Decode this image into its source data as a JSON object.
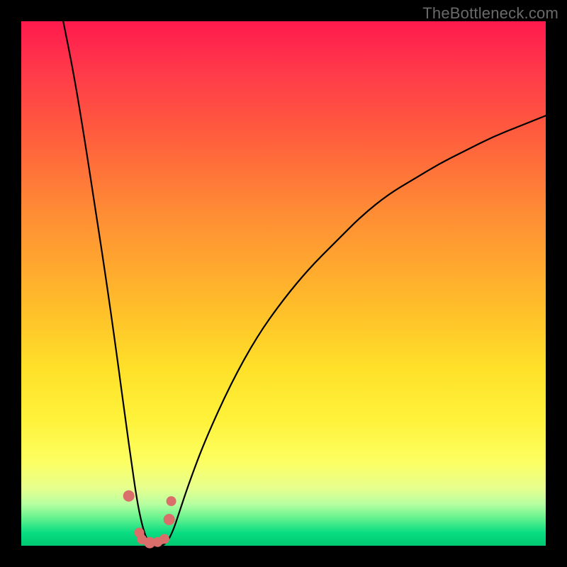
{
  "attribution": "TheBottleneck.com",
  "colors": {
    "background": "#000000",
    "gradient_top": "#ff1a4d",
    "gradient_bottom": "#01c973",
    "curve": "#000000",
    "marker": "#d96e6a"
  },
  "chart_data": {
    "type": "line",
    "title": "",
    "xlabel": "",
    "ylabel": "",
    "xlim": [
      0,
      100
    ],
    "ylim": [
      0,
      100
    ],
    "x": [
      8,
      10,
      12,
      14,
      16,
      18,
      20,
      21,
      22,
      23,
      24,
      25,
      26,
      27,
      28,
      29,
      30,
      32,
      35,
      40,
      45,
      50,
      55,
      60,
      65,
      70,
      75,
      80,
      85,
      90,
      95,
      100
    ],
    "values": [
      100,
      90,
      78,
      65,
      52,
      38,
      23,
      16,
      9,
      4,
      1,
      0,
      0,
      0,
      1,
      3,
      6,
      12,
      20,
      31,
      40,
      47,
      53,
      58,
      63,
      67,
      70,
      73,
      75.5,
      78,
      80,
      82
    ],
    "markers": {
      "x": [
        20.5,
        22.5,
        23.0,
        24.5,
        26.0,
        27.3,
        28.2,
        28.6
      ],
      "y": [
        9.5,
        2.5,
        1.2,
        0.6,
        0.7,
        1.3,
        5.0,
        8.5
      ]
    },
    "note": "Values are percentage-of-plot coordinates estimated from the unlabeled figure; y=0 at bottom, grid off, no legend."
  }
}
